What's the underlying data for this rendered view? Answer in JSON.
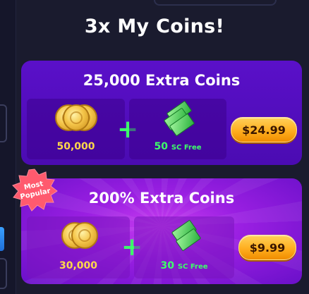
{
  "page": {
    "title": "3x My Coins!"
  },
  "offers": [
    {
      "title": "25,000 Extra Coins",
      "coins": "50,000",
      "sc_amount": "50",
      "sc_unit": "SC Free",
      "price": "$24.99"
    },
    {
      "title": "200% Extra Coins",
      "badge": "Most Popular",
      "coins": "30,000",
      "sc_amount": "30",
      "sc_unit": "SC Free",
      "price": "$9.99"
    }
  ],
  "icons": {
    "coins": "gold-coins-icon",
    "sweeps": "cash-stack-icon",
    "plus": "plus-icon",
    "badge": "starburst-badge"
  },
  "colors": {
    "background": "#1a1b2e",
    "card1": "#5a10c9",
    "card2": "#b52ee8",
    "coins_text": "#ffd84a",
    "sc_text": "#3dff6a",
    "price_button": "#ffae1f",
    "badge": "#ff5a6e"
  }
}
